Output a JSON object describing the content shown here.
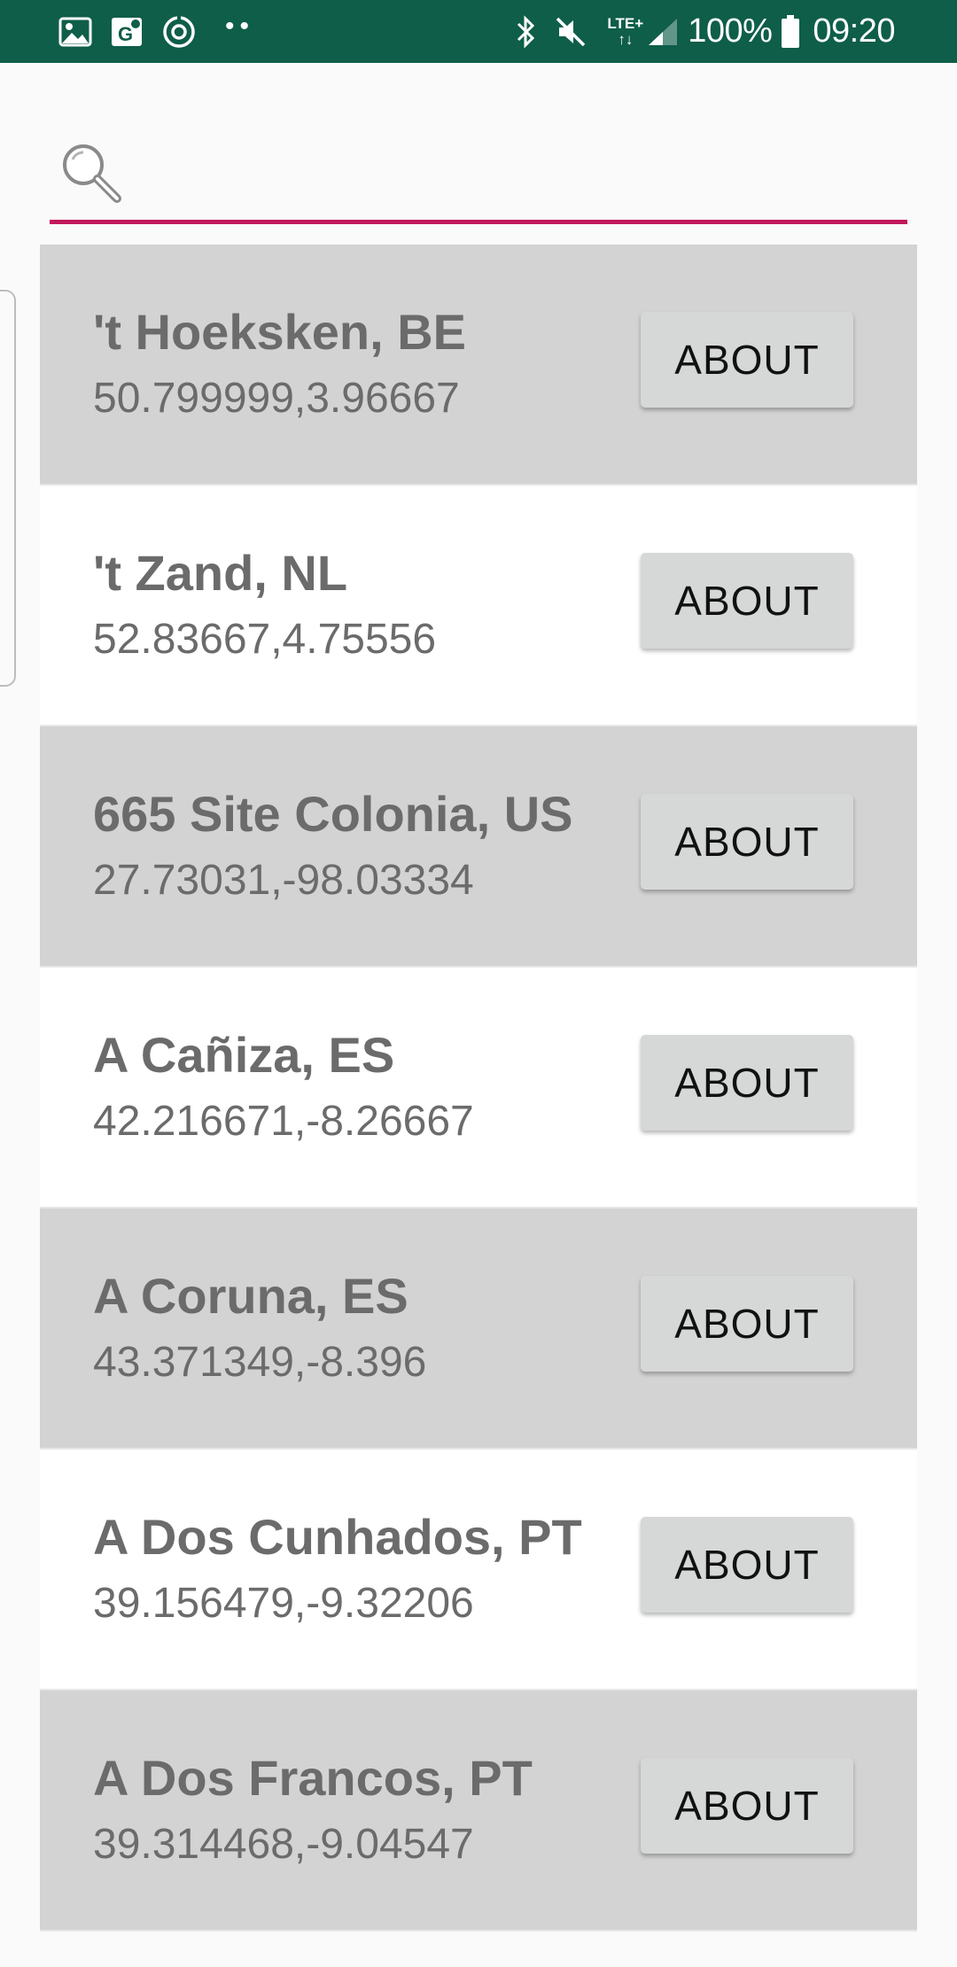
{
  "status_bar": {
    "battery_percent": "100%",
    "time": "09:20",
    "network_label_top": "LTE+",
    "network_label_bottom": "↑↓",
    "overflow_dots": "••",
    "icons_left": [
      "gallery-icon",
      "maps-icon",
      "sync-icon"
    ],
    "icons_right": [
      "bluetooth-icon",
      "mute-icon",
      "lte-icon",
      "signal-icon",
      "battery-icon"
    ],
    "background_color": "#0e5e49"
  },
  "search": {
    "value": "",
    "placeholder": "",
    "accent_color": "#c2185b"
  },
  "about_label": "ABOUT",
  "locations": [
    {
      "name": "'t Hoeksken, BE",
      "coords": "50.799999,3.96667"
    },
    {
      "name": "'t Zand, NL",
      "coords": "52.83667,4.75556"
    },
    {
      "name": "665 Site Colonia, US",
      "coords": "27.73031,-98.03334"
    },
    {
      "name": "A Cañiza, ES",
      "coords": "42.216671,-8.26667"
    },
    {
      "name": "A Coruna, ES",
      "coords": "43.371349,-8.396"
    },
    {
      "name": "A Dos Cunhados, PT",
      "coords": "39.156479,-9.32206"
    },
    {
      "name": "A Dos Francos, PT",
      "coords": "39.314468,-9.04547"
    }
  ]
}
